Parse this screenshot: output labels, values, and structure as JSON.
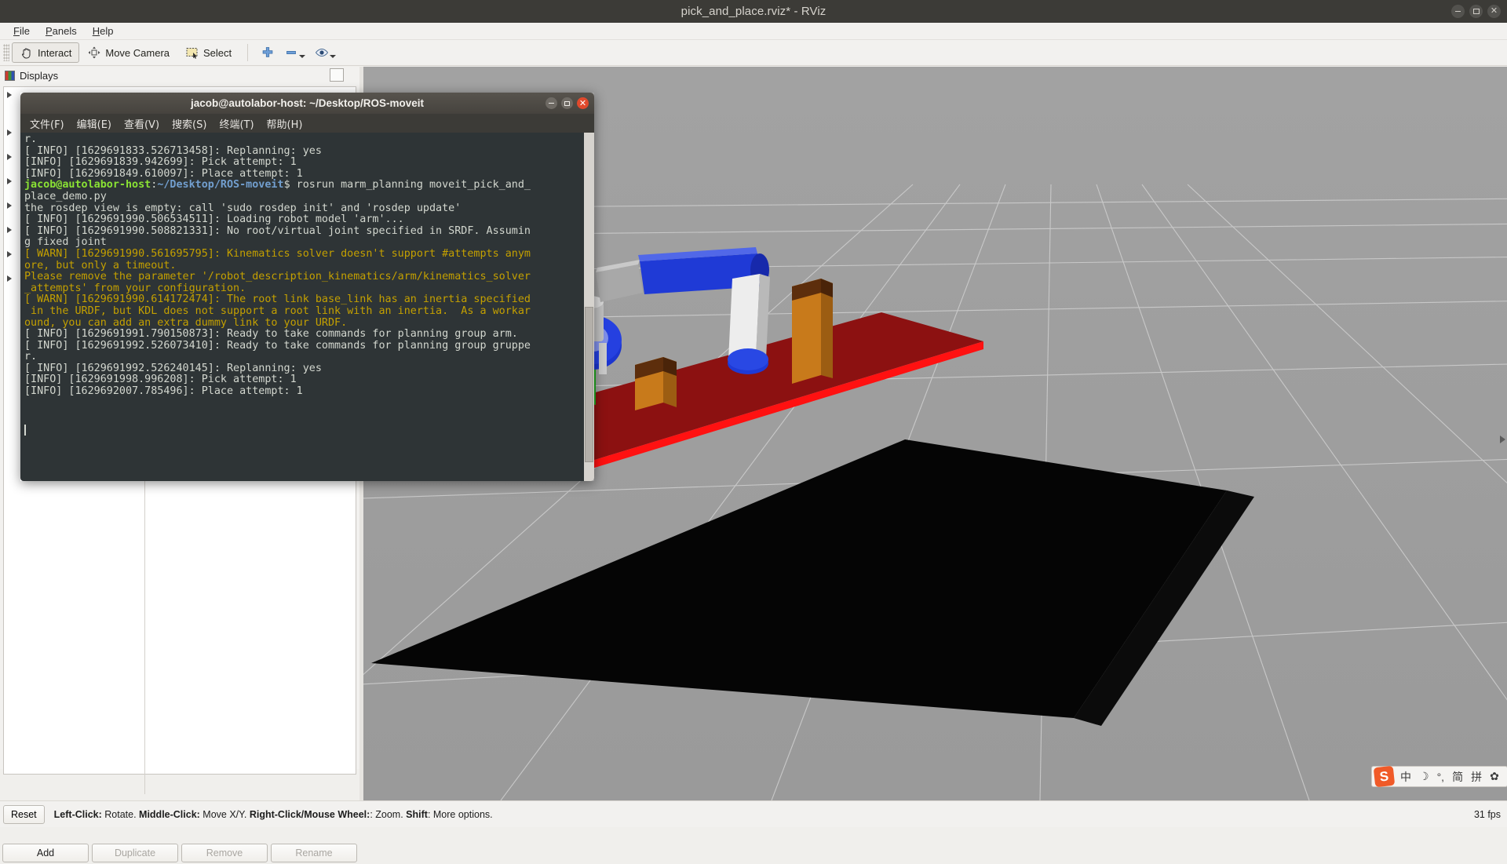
{
  "window": {
    "title": "pick_and_place.rviz* - RViz",
    "controls": [
      "minimize",
      "maximize",
      "close"
    ]
  },
  "menubar": {
    "items": [
      {
        "label": "File",
        "accel": "F"
      },
      {
        "label": "Panels",
        "accel": "P"
      },
      {
        "label": "Help",
        "accel": "H"
      }
    ]
  },
  "toolbar": {
    "buttons": [
      {
        "label": "Interact",
        "icon": "hand-cursor-icon",
        "active": true
      },
      {
        "label": "Move Camera",
        "icon": "move-camera-icon",
        "active": false
      },
      {
        "label": "Select",
        "icon": "select-rectangle-icon",
        "active": false
      }
    ],
    "icon_buttons": [
      {
        "name": "focus-camera-icon",
        "glyph": "+"
      },
      {
        "name": "measure-icon",
        "glyph": "-"
      },
      {
        "name": "publish-point-icon",
        "glyph": "eye"
      }
    ]
  },
  "displays_panel": {
    "title": "Displays",
    "float_button": "undock-displays",
    "tree_rows": 8,
    "buttons": [
      {
        "label": "Add",
        "enabled": true
      },
      {
        "label": "Duplicate",
        "enabled": false
      },
      {
        "label": "Remove",
        "enabled": false
      },
      {
        "label": "Rename",
        "enabled": false
      }
    ]
  },
  "statusbar": {
    "reset_label": "Reset",
    "hint_parts": [
      {
        "text": "Left-Click:",
        "bold": true
      },
      {
        "text": " Rotate. ",
        "bold": false
      },
      {
        "text": "Middle-Click:",
        "bold": true
      },
      {
        "text": " Move X/Y. ",
        "bold": false
      },
      {
        "text": "Right-Click/Mouse Wheel:",
        "bold": true
      },
      {
        "text": ": Zoom. ",
        "bold": false
      },
      {
        "text": "Shift",
        "bold": true
      },
      {
        "text": ": More options.",
        "bold": false
      }
    ],
    "fps": "31 fps"
  },
  "ime": {
    "logo": "S",
    "items": [
      "中",
      "☽",
      "°,",
      "简",
      "拼",
      "✿"
    ]
  },
  "terminal": {
    "title": "jacob@autolabor-host: ~/Desktop/ROS-moveit",
    "menu": [
      "文件(F)",
      "编辑(E)",
      "查看(V)",
      "搜索(S)",
      "终端(T)",
      "帮助(H)"
    ],
    "lines": [
      {
        "type": "plain",
        "text": "r."
      },
      {
        "type": "plain",
        "text": "[ INFO] [1629691833.526713458]: Replanning: yes"
      },
      {
        "type": "plain",
        "text": "[INFO] [1629691839.942699]: Pick attempt: 1"
      },
      {
        "type": "plain",
        "text": "[INFO] [1629691849.610097]: Place attempt: 1"
      },
      {
        "type": "prompt",
        "user": "jacob@autolabor-host",
        "sep": ":",
        "path": "~/Desktop/ROS-moveit",
        "cmd": "$ rosrun marm_planning moveit_pick_and_"
      },
      {
        "type": "plain",
        "text": "place_demo.py"
      },
      {
        "type": "plain",
        "text": "the rosdep view is empty: call 'sudo rosdep init' and 'rosdep update'"
      },
      {
        "type": "plain",
        "text": "[ INFO] [1629691990.506534511]: Loading robot model 'arm'..."
      },
      {
        "type": "plain",
        "text": "[ INFO] [1629691990.508821331]: No root/virtual joint specified in SRDF. Assumin"
      },
      {
        "type": "plain",
        "text": "g fixed joint"
      },
      {
        "type": "warn",
        "text": "[ WARN] [1629691990.561695795]: Kinematics solver doesn't support #attempts anym"
      },
      {
        "type": "warn",
        "text": "ore, but only a timeout."
      },
      {
        "type": "warn",
        "text": "Please remove the parameter '/robot_description_kinematics/arm/kinematics_solver"
      },
      {
        "type": "warn",
        "text": "_attempts' from your configuration."
      },
      {
        "type": "warn",
        "text": "[ WARN] [1629691990.614172474]: The root link base_link has an inertia specified"
      },
      {
        "type": "warn",
        "text": " in the URDF, but KDL does not support a root link with an inertia.  As a workar"
      },
      {
        "type": "warn",
        "text": "ound, you can add an extra dummy link to your URDF."
      },
      {
        "type": "plain",
        "text": "[ INFO] [1629691991.790150873]: Ready to take commands for planning group arm."
      },
      {
        "type": "plain",
        "text": "[ INFO] [1629691992.526073410]: Ready to take commands for planning group gruppe"
      },
      {
        "type": "plain",
        "text": "r."
      },
      {
        "type": "plain",
        "text": "[ INFO] [1629691992.526240145]: Replanning: yes"
      },
      {
        "type": "plain",
        "text": "[INFO] [1629691998.996208]: Pick attempt: 1"
      },
      {
        "type": "plain",
        "text": "[INFO] [1629692007.785496]: Place attempt: 1"
      }
    ]
  },
  "scene": {
    "background": "#9e9e9e",
    "grid_color": "#cfcfcf",
    "table_top": "#000000",
    "table_red": "#8e0f0f",
    "red_edge": "#ff0000",
    "box_orange": "#d4821e",
    "box_brown": "#6b3410",
    "arm_blue": "#1a37d8",
    "arm_white": "#e8e8e8",
    "arm_gray": "#9a9a9a",
    "green_rod": "#2fd02f"
  }
}
